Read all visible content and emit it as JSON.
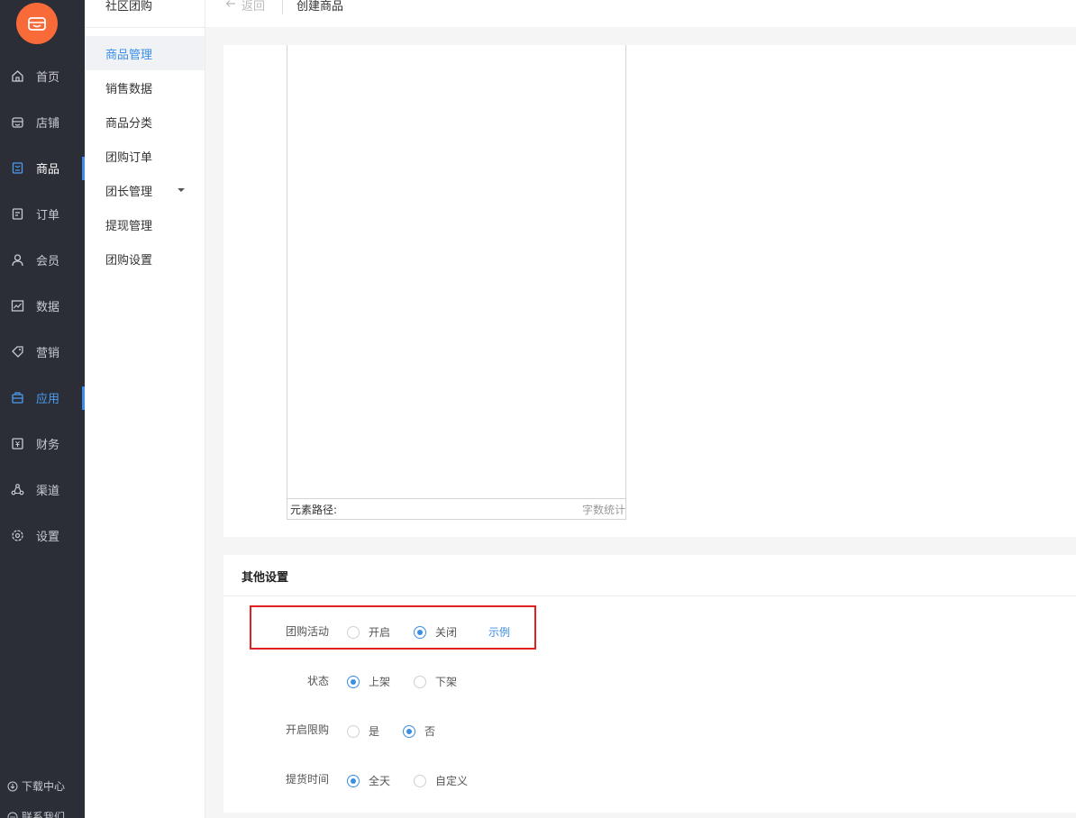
{
  "sidebar": {
    "items": [
      {
        "label": "首页",
        "icon": "home-icon"
      },
      {
        "label": "店铺",
        "icon": "store-icon"
      },
      {
        "label": "商品",
        "icon": "goods-icon"
      },
      {
        "label": "订单",
        "icon": "order-icon"
      },
      {
        "label": "会员",
        "icon": "member-icon"
      },
      {
        "label": "数据",
        "icon": "chart-icon"
      },
      {
        "label": "营销",
        "icon": "tag-icon"
      },
      {
        "label": "应用",
        "icon": "app-icon"
      },
      {
        "label": "财务",
        "icon": "finance-icon"
      },
      {
        "label": "渠道",
        "icon": "channel-icon"
      },
      {
        "label": "设置",
        "icon": "gear-icon"
      }
    ],
    "download_center": "下载中心",
    "contact_us": "联系我们"
  },
  "subnav": {
    "title": "社区团购",
    "items": [
      {
        "label": "商品管理"
      },
      {
        "label": "销售数据"
      },
      {
        "label": "商品分类"
      },
      {
        "label": "团购订单"
      },
      {
        "label": "团长管理"
      },
      {
        "label": "提现管理"
      },
      {
        "label": "团购设置"
      }
    ]
  },
  "topbar": {
    "back_label": "返回",
    "page_title": "创建商品"
  },
  "editor": {
    "path_label": "元素路径:",
    "word_count_label": "字数统计"
  },
  "other_settings": {
    "title": "其他设置",
    "group_buy": {
      "label": "团购活动",
      "on": "开启",
      "off": "关闭",
      "example": "示例",
      "selected": "off"
    },
    "status": {
      "label": "状态",
      "on": "上架",
      "off": "下架",
      "selected": "on"
    },
    "limit": {
      "label": "开启限购",
      "yes": "是",
      "no": "否",
      "selected": "no"
    },
    "pickup_time": {
      "label": "提货时间",
      "all_day": "全天",
      "custom": "自定义",
      "selected": "all_day"
    }
  },
  "colors": {
    "sidebar_bg": "#2b2e36",
    "accent": "#3a8ee6",
    "logo": "#f96a39",
    "highlight": "#e02020"
  }
}
